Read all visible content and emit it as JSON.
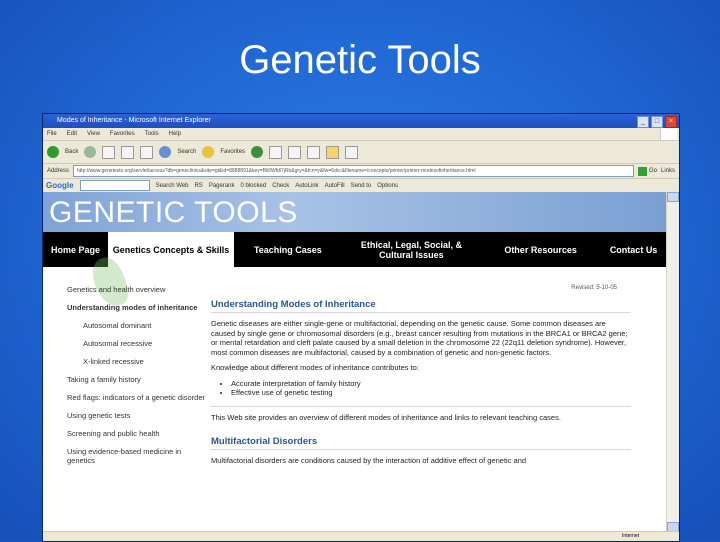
{
  "slide": {
    "title": "Genetic Tools"
  },
  "browser": {
    "window_title": "Modes of Inheritance - Microsoft Internet Explorer",
    "menu": [
      "File",
      "Edit",
      "View",
      "Favorites",
      "Tools",
      "Help"
    ],
    "toolbar": {
      "back": "Back",
      "search": "Search",
      "favorites": "Favorites"
    },
    "address": {
      "label": "Address",
      "url": "http://www.genetests.org/servlet/access?db=geneclinics&site=gt&id=8888891&key=Bli6Wfdl7jRb&gry=&fcn=y&fw=6dcc&filename=/concepts/primer/primer-modesofinheritance.html",
      "go": "Go",
      "links": "Links"
    },
    "google_toolbar": {
      "logo": "Google",
      "items": [
        "Search Web",
        "RS",
        "Pagerank",
        "0 blocked",
        "Check",
        "AutoLink",
        "AutoFill",
        "Send to",
        "Options"
      ]
    },
    "status": {
      "zone": "Internet"
    }
  },
  "site": {
    "banner_title": "GENETIC TOOLS",
    "nav": [
      {
        "label": "Home Page"
      },
      {
        "label": "Genetics Concepts & Skills"
      },
      {
        "label": "Teaching Cases"
      },
      {
        "label": "Ethical, Legal, Social, & Cultural Issues"
      },
      {
        "label": "Other Resources"
      },
      {
        "label": "Contact Us"
      }
    ],
    "sidebar": [
      "Genetics and health overview",
      "Understanding modes of inheritance",
      "Autosomal dominant",
      "Autosomal recessive",
      "X-linked recessive",
      "Taking a family history",
      "Red flags: indicators of a genetic disorder",
      "Using genetic tests",
      "Screening and public health",
      "Using evidence-based medicine in genetics"
    ],
    "revised": "Revised: 5-10-05",
    "main": {
      "heading": "Understanding Modes of Inheritance",
      "para1": "Genetic diseases are either single-gene or multifactorial, depending on the genetic cause. Some common diseases are caused by single gene or chromosomal disorders (e.g., breast cancer resulting from mutations in the BRCA1 or BRCA2 gene; or mental retardation and cleft palate caused by a small deletion in the chromosome 22 (22q11 deletion syndrome). However, most common diseases are multifactorial, caused by a combination of genetic and non-genetic factors.",
      "para2": "Knowledge about different modes of inheritance contributes to:",
      "bullets": [
        "Accurate interpretation of family history",
        "Effective use of genetic testing"
      ],
      "para3": "This Web site provides an overview of different modes of inheritance and links to relevant teaching cases.",
      "subheading": "Multifactorial Disorders",
      "para4": "Multifactorial disorders are conditions caused by the interaction of additive effect of genetic and"
    }
  }
}
